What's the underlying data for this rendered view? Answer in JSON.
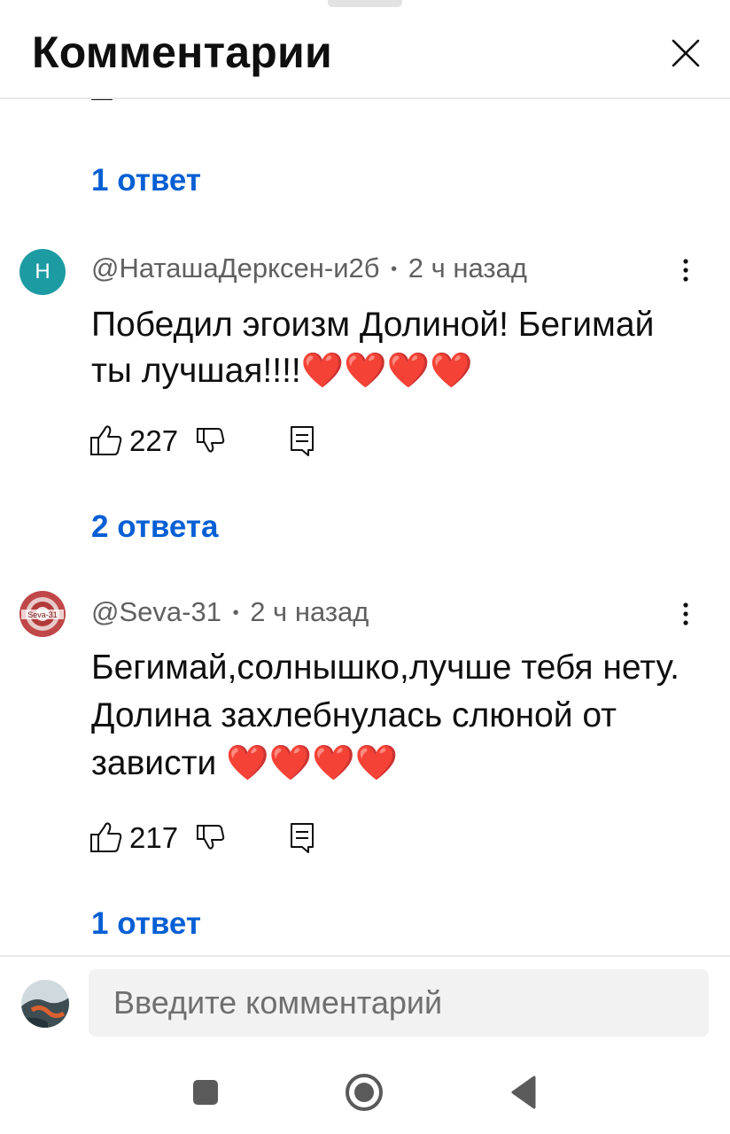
{
  "header": {
    "title": "Комментарии"
  },
  "feed": {
    "top_replies_label": "1 ответ",
    "comments": [
      {
        "avatar_letter": "Н",
        "author": "@НаташаДерксен-и2б",
        "time": "2 ч назад",
        "separator": "•",
        "text": "Победил эгоизм Долиной! Бегимай ты лучшая!!!!❤️❤️❤️❤️",
        "likes": "227",
        "replies_label": "2 ответа"
      },
      {
        "avatar_text": "Seva-31",
        "author": "@Seva-31",
        "time": "2 ч назад",
        "separator": "•",
        "text": "Бегимай,солнышко,лучше тебя нету. Долина захлебнулась слюной от зависти ❤️❤️❤️❤️",
        "likes": "217",
        "replies_label": "1 ответ"
      }
    ]
  },
  "input": {
    "placeholder": "Введите комментарий"
  },
  "icons": {
    "close": "close-icon",
    "more": "more-vertical-icon",
    "like": "thumb-up-icon",
    "dislike": "thumb-down-icon",
    "reply": "reply-icon",
    "nav_recents": "square-icon",
    "nav_home": "circle-icon",
    "nav_back": "triangle-back-icon"
  },
  "colors": {
    "link": "#065fd4",
    "avatar_n": "#1d9ba3",
    "heart": "#e0202c"
  }
}
